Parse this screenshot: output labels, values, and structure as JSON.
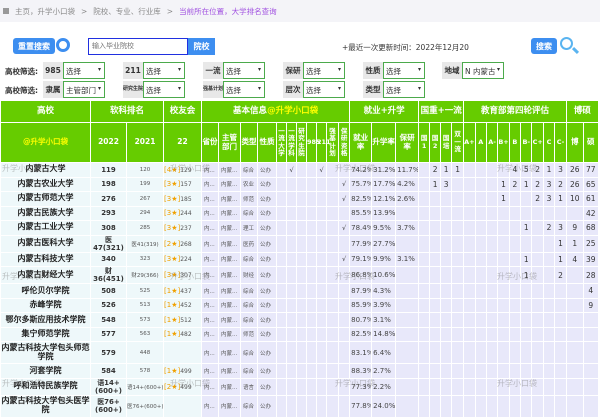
{
  "breadcrumb": {
    "home": "主页，升学小口袋",
    "sep": ">",
    "section": "院校、专业、行业库",
    "current": "当前所在位置，大学排名查询"
  },
  "toolbar": {
    "reset": "重置搜索",
    "search_placeholder": "输入毕业院校",
    "school_btn": "院校",
    "update": "+最近一次更新时间：2022年12月20",
    "search": "搜索"
  },
  "filters": {
    "label": "高校筛选:",
    "row1": [
      {
        "k": "985",
        "v": "选择"
      },
      {
        "k": "211",
        "v": "选择"
      },
      {
        "k": "一流",
        "v": "选择"
      },
      {
        "k": "保研",
        "v": "选择"
      },
      {
        "k": "性质",
        "v": "选择"
      },
      {
        "k": "地域",
        "v": "N 内蒙古"
      }
    ],
    "row2": [
      {
        "k": "隶属",
        "v": "主管部门"
      },
      {
        "k": "研究生院",
        "v": "选择"
      },
      {
        "k": "强基计划",
        "v": "选择"
      },
      {
        "k": "层次",
        "v": "选择"
      },
      {
        "k": "类型",
        "v": "选择"
      }
    ]
  },
  "table": {
    "groups": [
      "高校",
      "软科排名",
      "校友会",
      "基本信息@升学小口袋",
      "就业+升学",
      "国重+一流",
      "教育部第四轮评估",
      "博硕"
    ],
    "sub": [
      "@升学小口袋",
      "2022",
      "2021",
      "22",
      "省份",
      "主管部门",
      "类型",
      "性质",
      "一流大学",
      "一流学科",
      "研究生院",
      "985",
      "211",
      "强基计划",
      "保研资格",
      "就业率",
      "升学率",
      "保研率",
      "国1",
      "国2",
      "国培",
      "双一流",
      "A+",
      "A",
      "A-",
      "B+",
      "B",
      "B-",
      "C+",
      "C",
      "C-",
      "博",
      "硕"
    ],
    "rows": [
      {
        "name": "内蒙古大学",
        "r22": "119",
        "r21": "120",
        "star": "[4★]",
        "alum": "129",
        "prov": "内...",
        "dept": "内蒙...",
        "type": "综合",
        "nat": "公办",
        "flags": [
          "",
          "√",
          "",
          "",
          "√",
          "",
          ""
        ],
        "emp": "74.2%",
        "up": "31.2%",
        "by": "11.7%",
        "gz": [
          "",
          "2",
          "1",
          "1"
        ],
        "ev": [
          "",
          "",
          "",
          "",
          "4",
          "5",
          "2",
          "1",
          "3"
        ],
        "bo": "26",
        "shuo": "77"
      },
      {
        "name": "内蒙古农业大学",
        "r22": "198",
        "r21": "199",
        "star": "[3★]",
        "alum": "157",
        "prov": "内...",
        "dept": "内蒙...",
        "type": "农业",
        "nat": "公办",
        "flags": [
          "",
          "",
          "",
          "",
          "",
          "",
          "√"
        ],
        "emp": "75.7%",
        "up": "17.7%",
        "by": "4.2%",
        "gz": [
          "",
          "1",
          "3",
          ""
        ],
        "ev": [
          "",
          "",
          "",
          "1",
          "2",
          "1",
          "2",
          "3",
          "2"
        ],
        "bo": "26",
        "shuo": "65"
      },
      {
        "name": "内蒙古师范大学",
        "r22": "276",
        "r21": "267",
        "star": "[3★]",
        "alum": "185",
        "prov": "内...",
        "dept": "内蒙...",
        "type": "师范",
        "nat": "公办",
        "flags": [
          "",
          "",
          "",
          "",
          "",
          "",
          "√"
        ],
        "emp": "82.5%",
        "up": "12.1%",
        "by": "2.6%",
        "gz": [
          "",
          "",
          "",
          ""
        ],
        "ev": [
          "",
          "",
          "",
          "1",
          "",
          "",
          "2",
          "3",
          "1"
        ],
        "bo": "10",
        "shuo": "61"
      },
      {
        "name": "内蒙古民族大学",
        "r22": "293",
        "r21": "294",
        "star": "[3★]",
        "alum": "244",
        "prov": "内...",
        "dept": "内蒙...",
        "type": "综合",
        "nat": "公办",
        "flags": [
          "",
          "",
          "",
          "",
          "",
          "",
          ""
        ],
        "emp": "85.5%",
        "up": "13.9%",
        "by": "",
        "gz": [
          "",
          "",
          "",
          ""
        ],
        "ev": [
          "",
          "",
          "",
          "",
          "",
          "",
          "",
          "",
          ""
        ],
        "bo": "",
        "shuo": "42"
      },
      {
        "name": "内蒙古工业大学",
        "r22": "308",
        "r21": "285",
        "star": "[3★]",
        "alum": "237",
        "prov": "内...",
        "dept": "内蒙...",
        "type": "理工",
        "nat": "公办",
        "flags": [
          "",
          "",
          "",
          "",
          "",
          "",
          "√"
        ],
        "emp": "78.4%",
        "up": "9.5%",
        "by": "3.7%",
        "gz": [
          "",
          "",
          "",
          ""
        ],
        "ev": [
          "",
          "",
          "",
          "",
          "",
          "1",
          "",
          "2",
          "3"
        ],
        "bo": "9",
        "shuo": "68"
      },
      {
        "name": "内蒙古医科大学",
        "r22": "医47(321)",
        "r21": "医41(319)",
        "star": "[2★]",
        "alum": "268",
        "prov": "内...",
        "dept": "内蒙...",
        "type": "医药",
        "nat": "公办",
        "flags": [
          "",
          "",
          "",
          "",
          "",
          "",
          ""
        ],
        "emp": "77.9%",
        "up": "27.7%",
        "by": "",
        "gz": [
          "",
          "",
          "",
          ""
        ],
        "ev": [
          "",
          "",
          "",
          "",
          "",
          "",
          "",
          "",
          "1"
        ],
        "bo": "1",
        "shuo": "25"
      },
      {
        "name": "内蒙古科技大学",
        "r22": "340",
        "r21": "323",
        "star": "[3★]",
        "alum": "224",
        "prov": "内...",
        "dept": "内蒙...",
        "type": "综合",
        "nat": "公办",
        "flags": [
          "",
          "",
          "",
          "",
          "",
          "",
          "√"
        ],
        "emp": "79.1%",
        "up": "9.9%",
        "by": "3.1%",
        "gz": [
          "",
          "",
          "",
          ""
        ],
        "ev": [
          "",
          "",
          "",
          "",
          "",
          "1",
          "",
          "",
          "1"
        ],
        "bo": "4",
        "shuo": "39"
      },
      {
        "name": "内蒙古财经大学",
        "r22": "财36(451)",
        "r21": "财29(366)",
        "star": "[3★]",
        "alum": "307",
        "prov": "内...",
        "dept": "内蒙...",
        "type": "财经",
        "nat": "公办",
        "flags": [
          "",
          "",
          "",
          "",
          "",
          "",
          ""
        ],
        "emp": "86.8%",
        "up": "10.6%",
        "by": "",
        "gz": [
          "",
          "",
          "",
          ""
        ],
        "ev": [
          "",
          "",
          "",
          "",
          "",
          "1",
          "",
          "",
          "2"
        ],
        "bo": "",
        "shuo": "28"
      },
      {
        "name": "呼伦贝尔学院",
        "r22": "508",
        "r21": "525",
        "star": "[1★]",
        "alum": "437",
        "prov": "内...",
        "dept": "内蒙...",
        "type": "综合",
        "nat": "公办",
        "flags": [
          "",
          "",
          "",
          "",
          "",
          "",
          ""
        ],
        "emp": "87.9%",
        "up": "4.3%",
        "by": "",
        "gz": [
          "",
          "",
          "",
          ""
        ],
        "ev": [
          "",
          "",
          "",
          "",
          "",
          "",
          "",
          "",
          ""
        ],
        "bo": "",
        "shuo": "4"
      },
      {
        "name": "赤峰学院",
        "r22": "526",
        "r21": "513",
        "star": "[1★]",
        "alum": "452",
        "prov": "内...",
        "dept": "内蒙...",
        "type": "综合",
        "nat": "公办",
        "flags": [
          "",
          "",
          "",
          "",
          "",
          "",
          ""
        ],
        "emp": "85.9%",
        "up": "3.9%",
        "by": "",
        "gz": [
          "",
          "",
          "",
          ""
        ],
        "ev": [
          "",
          "",
          "",
          "",
          "",
          "",
          "",
          "",
          ""
        ],
        "bo": "",
        "shuo": "9"
      },
      {
        "name": "鄂尔多斯应用技术学院",
        "r22": "548",
        "r21": "573",
        "star": "[1★]",
        "alum": "512",
        "prov": "内...",
        "dept": "内蒙...",
        "type": "综合",
        "nat": "公办",
        "flags": [
          "",
          "",
          "",
          "",
          "",
          "",
          ""
        ],
        "emp": "80.7%",
        "up": "3.1%",
        "by": "",
        "gz": [
          "",
          "",
          "",
          ""
        ],
        "ev": [
          "",
          "",
          "",
          "",
          "",
          "",
          "",
          "",
          ""
        ],
        "bo": "",
        "shuo": ""
      },
      {
        "name": "集宁师范学院",
        "r22": "577",
        "r21": "563",
        "star": "[1★]",
        "alum": "482",
        "prov": "内...",
        "dept": "内蒙...",
        "type": "师范",
        "nat": "公办",
        "flags": [
          "",
          "",
          "",
          "",
          "",
          "",
          ""
        ],
        "emp": "82.5%",
        "up": "14.8%",
        "by": "",
        "gz": [
          "",
          "",
          "",
          ""
        ],
        "ev": [
          "",
          "",
          "",
          "",
          "",
          "",
          "",
          "",
          ""
        ],
        "bo": "",
        "shuo": ""
      },
      {
        "name": "内蒙古科技大学包头师范学院",
        "r22": "579",
        "r21": "448",
        "star": "",
        "alum": "",
        "prov": "内...",
        "dept": "内蒙...",
        "type": "综合",
        "nat": "公办",
        "flags": [
          "",
          "",
          "",
          "",
          "",
          "",
          ""
        ],
        "emp": "83.1%",
        "up": "6.4%",
        "by": "",
        "gz": [
          "",
          "",
          "",
          ""
        ],
        "ev": [
          "",
          "",
          "",
          "",
          "",
          "",
          "",
          "",
          ""
        ],
        "bo": "",
        "shuo": ""
      },
      {
        "name": "河套学院",
        "r22": "584",
        "r21": "578",
        "star": "[1★]",
        "alum": "499",
        "prov": "内...",
        "dept": "内蒙...",
        "type": "综合",
        "nat": "公办",
        "flags": [
          "",
          "",
          "",
          "",
          "",
          "",
          ""
        ],
        "emp": "88.3%",
        "up": "2.7%",
        "by": "",
        "gz": [
          "",
          "",
          "",
          ""
        ],
        "ev": [
          "",
          "",
          "",
          "",
          "",
          "",
          "",
          "",
          ""
        ],
        "bo": "",
        "shuo": ""
      },
      {
        "name": "呼和浩特民族学院",
        "r22": "语14+(600+)",
        "r21": "语14+(600+)",
        "star": "[2★]",
        "alum": "499",
        "prov": "内...",
        "dept": "内蒙...",
        "type": "语言",
        "nat": "公办",
        "flags": [
          "",
          "",
          "",
          "",
          "",
          "",
          ""
        ],
        "emp": "77.3%",
        "up": "2.2%",
        "by": "",
        "gz": [
          "",
          "",
          "",
          ""
        ],
        "ev": [
          "",
          "",
          "",
          "",
          "",
          "",
          "",
          "",
          ""
        ],
        "bo": "",
        "shuo": ""
      },
      {
        "name": "内蒙古科技大学包头医学院",
        "r22": "医76+(600+)",
        "r21": "医76+(600+)",
        "star": "",
        "alum": "",
        "prov": "内...",
        "dept": "内蒙...",
        "type": "综合",
        "nat": "公办",
        "flags": [
          "",
          "",
          "",
          "",
          "",
          "",
          ""
        ],
        "emp": "77.8%",
        "up": "24.0%",
        "by": "",
        "gz": [
          "",
          "",
          "",
          ""
        ],
        "ev": [
          "",
          "",
          "",
          "",
          "",
          "",
          "",
          "",
          ""
        ],
        "bo": "",
        "shuo": ""
      }
    ]
  },
  "watermark": "升学小口袋"
}
